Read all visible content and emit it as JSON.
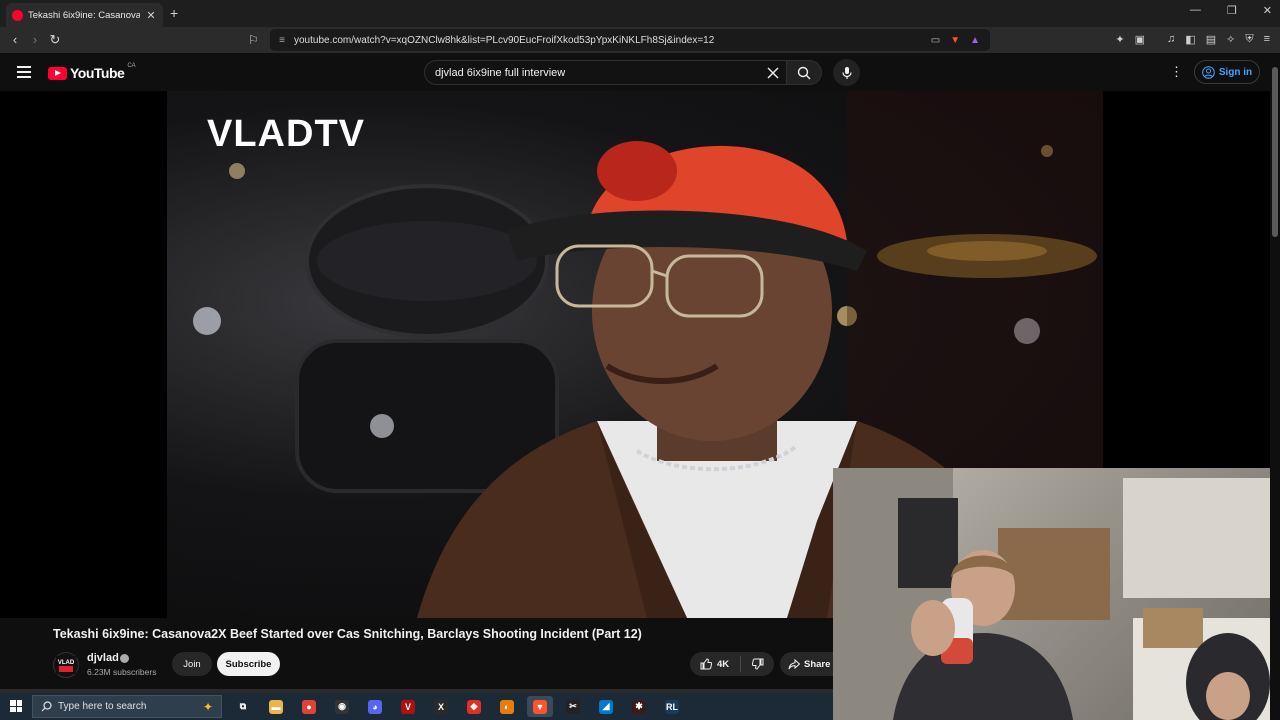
{
  "browser": {
    "tab_title": "Tekashi 6ix9ine: Casanova2X Beef Started over Cas Snitching, Barclays Shooting Incident (Part 12)",
    "tab_close": "✕",
    "new_tab": "+",
    "url": "youtube.com/watch?v=xqOZNClw8hk&list=PLcv90EucFroifXkod53pYpxKiNKLFh8Sj&index=12",
    "window_controls": [
      "—",
      "❐",
      "✕"
    ]
  },
  "header": {
    "logo_text": "YouTube",
    "country": "CA",
    "search_value": "djvlad 6ix9ine full interview",
    "signin_label": "Sign in"
  },
  "video": {
    "watermark": "VLADTV",
    "title": "Tekashi 6ix9ine: Casanova2X Beef Started over Cas Snitching, Barclays Shooting Incident (Part 12)",
    "channel": {
      "name": "djvlad",
      "avatar_text": "VLAD",
      "subscribers": "6.23M subscribers"
    },
    "join_label": "Join",
    "subscribe_label": "Subscribe",
    "like_count": "4K",
    "share_label": "Share"
  },
  "taskbar": {
    "search_placeholder": "Type here to search",
    "apps": [
      {
        "name": "task-view-app",
        "glyph": "⧉",
        "color": "#1c2a38"
      },
      {
        "name": "file-explorer-app",
        "glyph": "▬",
        "color": "#e8b64c"
      },
      {
        "name": "chrome-app",
        "glyph": "●",
        "color": "#db4437"
      },
      {
        "name": "obs-app",
        "glyph": "◉",
        "color": "#333333"
      },
      {
        "name": "discord-app",
        "glyph": "◕",
        "color": "#5865f2"
      },
      {
        "name": "voicemeeter-app",
        "glyph": "V",
        "color": "#b01010"
      },
      {
        "name": "x-app",
        "glyph": "X",
        "color": "#2a2a2a"
      },
      {
        "name": "red-app",
        "glyph": "◆",
        "color": "#e03020"
      },
      {
        "name": "blender-app",
        "glyph": "◐",
        "color": "#e87d0d"
      },
      {
        "name": "brave-app",
        "glyph": "▼",
        "color": "#fb542b"
      },
      {
        "name": "capcut-app",
        "glyph": "✂",
        "color": "#222222"
      },
      {
        "name": "vscode-app",
        "glyph": "◢",
        "color": "#007acc"
      },
      {
        "name": "dark-app",
        "glyph": "✱",
        "color": "#3a1a1a"
      },
      {
        "name": "rl-app",
        "glyph": "RL",
        "color": "#1a3a5a"
      }
    ]
  },
  "colors": {
    "youtube_red": "#ff0033",
    "link_blue": "#3ea6ff",
    "background": "#0f0f0f"
  }
}
